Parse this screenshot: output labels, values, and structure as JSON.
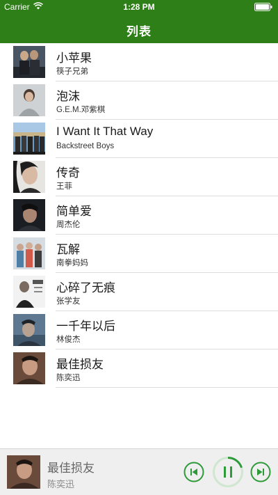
{
  "status_bar": {
    "carrier": "Carrier",
    "time": "1:28 PM",
    "wifi_icon": "wifi-icon",
    "battery_icon": "battery-icon"
  },
  "nav": {
    "title": "列表"
  },
  "colors": {
    "brand_green": "#2f7f19",
    "control_green": "#2f9a3a",
    "separator": "#dcdcdc"
  },
  "songs": [
    {
      "title": "小苹果",
      "artist": "筷子兄弟"
    },
    {
      "title": "泡沫",
      "artist": "G.E.M.邓紫棋"
    },
    {
      "title": "I Want It That Way",
      "artist": "Backstreet Boys"
    },
    {
      "title": "传奇",
      "artist": "王菲"
    },
    {
      "title": "简单爱",
      "artist": "周杰伦"
    },
    {
      "title": "瓦解",
      "artist": "南拳妈妈"
    },
    {
      "title": "心碎了无痕",
      "artist": "张学友"
    },
    {
      "title": "一千年以后",
      "artist": "林俊杰"
    },
    {
      "title": "最佳损友",
      "artist": "陈奕迅"
    }
  ],
  "player": {
    "title": "最佳损友",
    "artist": "陈奕迅",
    "prev_icon": "skip-previous-icon",
    "play_icon": "pause-icon",
    "next_icon": "skip-next-icon",
    "progress": 0.2
  }
}
